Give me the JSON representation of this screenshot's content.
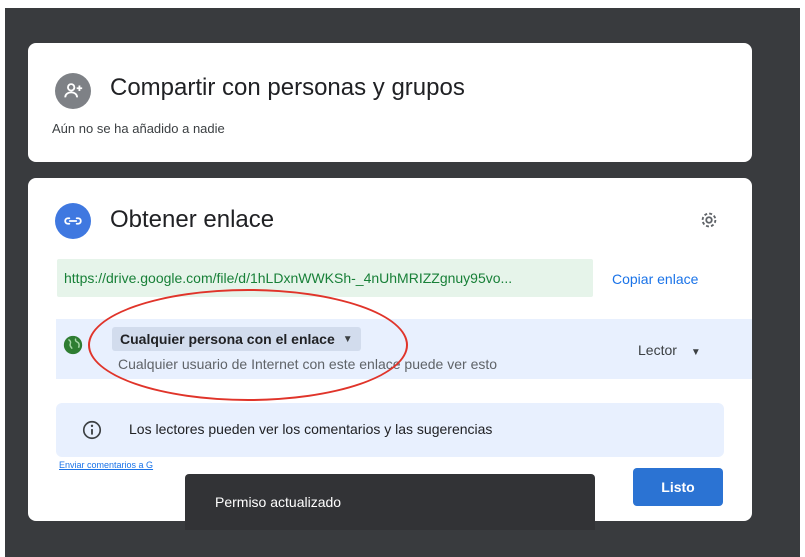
{
  "share": {
    "title": "Compartir con personas y grupos",
    "empty_text": "Aún no se ha añadido a nadie",
    "icon": "person-add-icon"
  },
  "link": {
    "title": "Obtener enlace",
    "icon": "link-icon",
    "settings_icon": "gear-icon",
    "url": "https://drive.google.com/file/d/1hLDxnWWKSh-_4nUhMRIZZgnuy95vo...",
    "copy_label": "Copiar enlace",
    "access_level": "Cualquier persona con el enlace",
    "access_description": "Cualquier usuario de Internet con este enlace puede ver esto",
    "role": "Lector",
    "info_text": "Los lectores pueden ver los comentarios y las sugerencias",
    "feedback_label": "Enviar comentarios a G",
    "done_label": "Listo"
  },
  "toast": {
    "text": "Permiso actualizado"
  },
  "colors": {
    "backdrop": "#393b3e",
    "primary": "#1a73e8",
    "url_background": "#e6f4ea",
    "url_text": "#188038",
    "highlight_row": "#e8f0fe",
    "annotation": "#e0342a",
    "toast_background": "#323336"
  }
}
